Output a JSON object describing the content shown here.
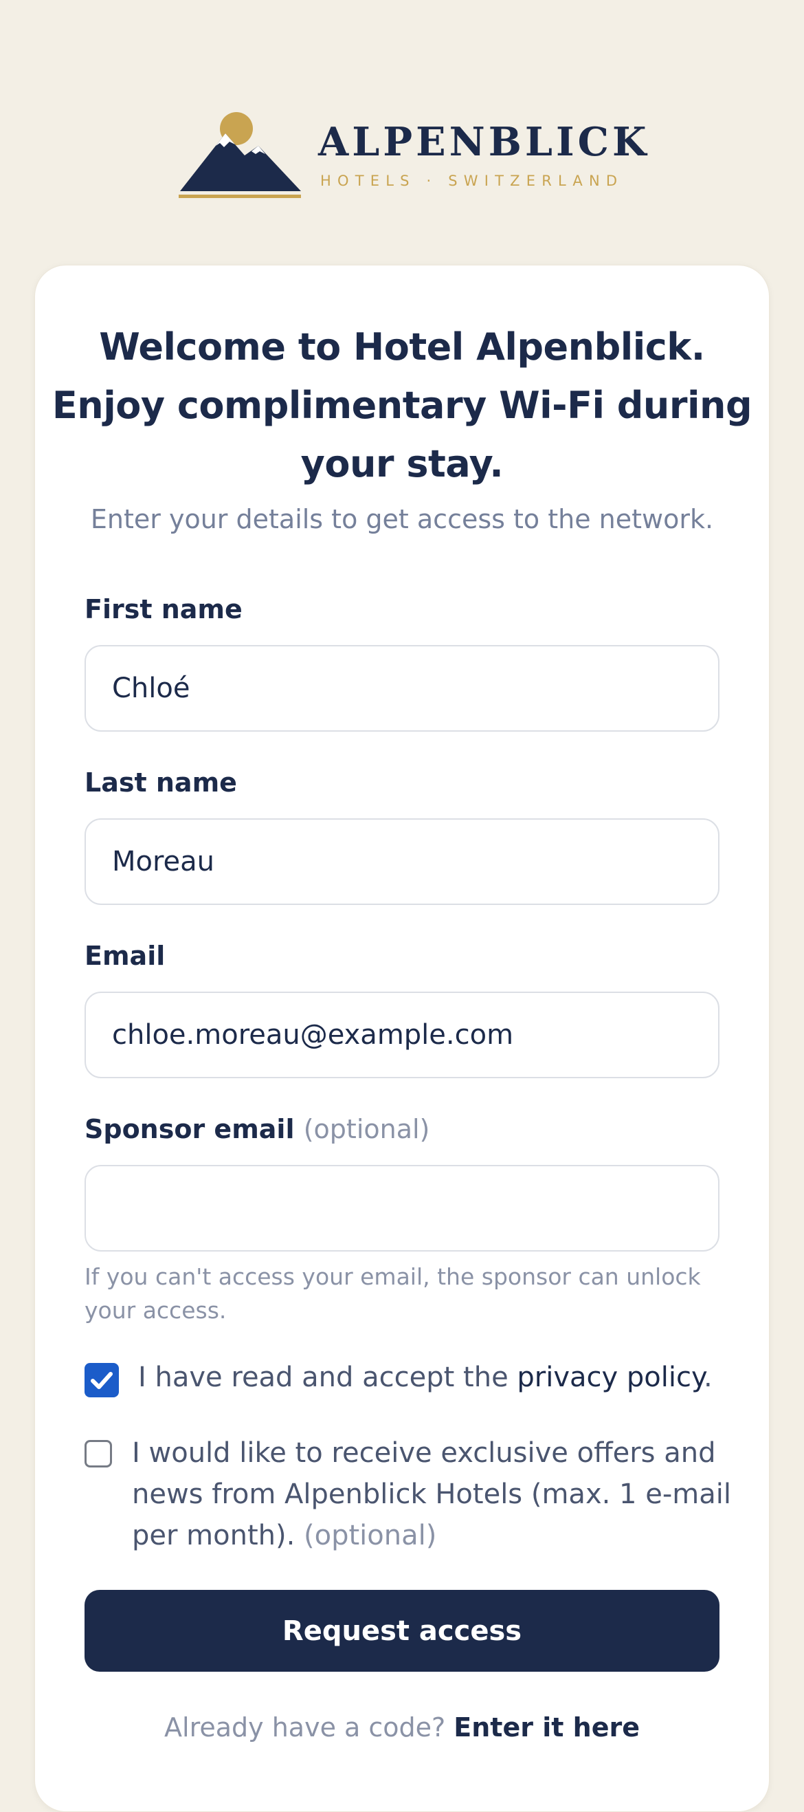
{
  "brand": {
    "name": "ALPENBLICK",
    "tagline": "HOTELS · SWITZERLAND",
    "logo_icon": "mountain-sun-logo",
    "colors": {
      "navy": "#1c2a4a",
      "gold": "#c9a451",
      "background": "#f3efe5"
    }
  },
  "header": {
    "title_line1": "Welcome to Hotel Alpenblick.",
    "title_line2": "Enjoy complimentary Wi-Fi during",
    "title_line3": "your stay.",
    "subtitle": "Enter your details to get access to the network."
  },
  "form": {
    "first_name": {
      "label": "First name",
      "value": "Chloé"
    },
    "last_name": {
      "label": "Last name",
      "value": "Moreau"
    },
    "email": {
      "label": "Email",
      "value": "chloe.moreau@example.com"
    },
    "sponsor_email": {
      "label": "Sponsor email",
      "optional_note": "(optional)",
      "value": "",
      "help_text": "If you can't access your email, the sponsor can unlock your access."
    },
    "privacy_consent": {
      "checked": true,
      "text_before": "I have read and accept the ",
      "link_text": "privacy policy",
      "text_after": "."
    },
    "newsletter": {
      "checked": false,
      "text": "I would like to receive exclusive offers and news from Alpenblick Hotels (max. 1 e-mail per month).",
      "optional_note": "(optional)"
    },
    "submit_label": "Request access"
  },
  "footer": {
    "prompt": "Already have a code?",
    "link_text": "Enter it here"
  }
}
